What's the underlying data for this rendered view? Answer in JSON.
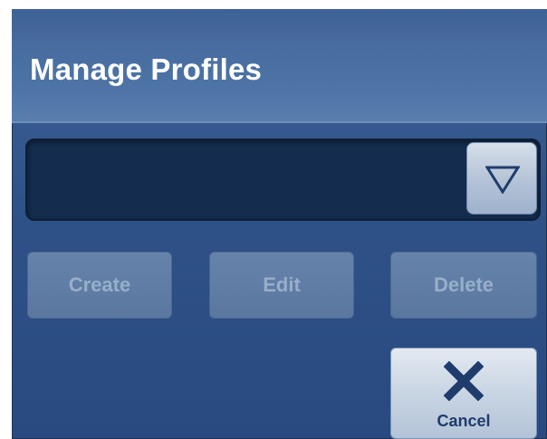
{
  "dialog": {
    "title": "Manage Profiles"
  },
  "profile_select": {
    "value": "",
    "arrow_icon": "triangle-down-outline-icon"
  },
  "buttons": {
    "create": {
      "label": "Create",
      "enabled": false
    },
    "edit": {
      "label": "Edit",
      "enabled": false
    },
    "delete": {
      "label": "Delete",
      "enabled": false
    },
    "cancel": {
      "label": "Cancel",
      "icon": "close-x-icon",
      "enabled": true
    }
  },
  "colors": {
    "dialog_background": "#2f5288",
    "title_background": "#4e74a6",
    "combo_background": "#142d4e",
    "disabled_button": "#6280a8",
    "disabled_text": "#98aecb",
    "cancel_icon": "#1e3c6c"
  }
}
